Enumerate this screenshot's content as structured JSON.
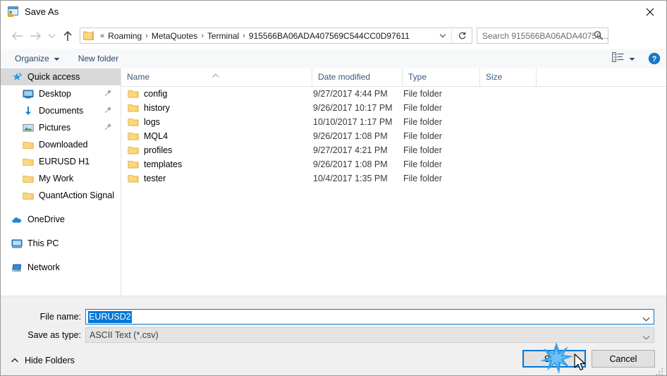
{
  "window": {
    "title": "Save As",
    "title_icon": "save-as-icon",
    "close_icon": "close-icon"
  },
  "nav": {
    "back_icon": "arrow-left-icon",
    "forward_icon": "arrow-right-icon",
    "recent_icon": "chevron-down-icon",
    "up_icon": "arrow-up-icon",
    "breadcrumb_icon": "folder-icon",
    "breadcrumb_overflow": "«",
    "crumbs": [
      "Roaming",
      "MetaQuotes",
      "Terminal",
      "915566BA06ADA407569C544CC0D97611"
    ],
    "separator": "›",
    "dropdown_icon": "chevron-down-icon",
    "refresh_icon": "refresh-icon"
  },
  "search": {
    "placeholder": "Search 915566BA06ADA40756...",
    "icon": "search-icon"
  },
  "toolbar": {
    "organize_label": "Organize",
    "organize_caret_icon": "caret-down-icon",
    "new_folder_label": "New folder",
    "view_icon": "list-view-icon",
    "view_caret_icon": "caret-down-icon",
    "help_icon": "help-icon"
  },
  "sidebar": {
    "items": [
      {
        "label": "Quick access",
        "icon": "star-pin-icon",
        "level": 0,
        "selected": true,
        "pinned": false
      },
      {
        "label": "Desktop",
        "icon": "desktop-icon",
        "level": 1,
        "selected": false,
        "pinned": true
      },
      {
        "label": "Documents",
        "icon": "documents-icon",
        "level": 1,
        "selected": false,
        "pinned": true
      },
      {
        "label": "Pictures",
        "icon": "pictures-icon",
        "level": 1,
        "selected": false,
        "pinned": true
      },
      {
        "label": "Downloaded",
        "icon": "folder-icon",
        "level": 1,
        "selected": false,
        "pinned": false
      },
      {
        "label": "EURUSD H1",
        "icon": "folder-icon",
        "level": 1,
        "selected": false,
        "pinned": false
      },
      {
        "label": "My Work",
        "icon": "folder-icon",
        "level": 1,
        "selected": false,
        "pinned": false
      },
      {
        "label": "QuantAction Signal",
        "icon": "folder-icon",
        "level": 1,
        "selected": false,
        "pinned": false
      },
      {
        "label": "OneDrive",
        "icon": "onedrive-icon",
        "level": 0,
        "selected": false,
        "pinned": false,
        "gap_before": true
      },
      {
        "label": "This PC",
        "icon": "this-pc-icon",
        "level": 0,
        "selected": false,
        "pinned": false,
        "gap_before": true
      },
      {
        "label": "Network",
        "icon": "network-icon",
        "level": 0,
        "selected": false,
        "pinned": false,
        "gap_before": true
      }
    ]
  },
  "filelist": {
    "columns": [
      "Name",
      "Date modified",
      "Type",
      "Size"
    ],
    "sort_indicator_icon": "sort-ascending-icon",
    "rows": [
      {
        "name": "config",
        "date": "9/27/2017 4:44 PM",
        "type": "File folder",
        "size": ""
      },
      {
        "name": "history",
        "date": "9/26/2017 10:17 PM",
        "type": "File folder",
        "size": ""
      },
      {
        "name": "logs",
        "date": "10/10/2017 1:17 PM",
        "type": "File folder",
        "size": ""
      },
      {
        "name": "MQL4",
        "date": "9/26/2017 1:08 PM",
        "type": "File folder",
        "size": ""
      },
      {
        "name": "profiles",
        "date": "9/27/2017 4:21 PM",
        "type": "File folder",
        "size": ""
      },
      {
        "name": "templates",
        "date": "9/26/2017 1:08 PM",
        "type": "File folder",
        "size": ""
      },
      {
        "name": "tester",
        "date": "10/4/2017 1:35 PM",
        "type": "File folder",
        "size": ""
      }
    ]
  },
  "form": {
    "filename_label": "File name:",
    "filename_value": "EURUSD2",
    "filetype_label": "Save as type:",
    "filetype_value": "ASCII Text (*.csv)",
    "dropdown_icon": "chevron-down-icon"
  },
  "footer": {
    "hide_folders_label": "Hide Folders",
    "hide_folders_icon": "chevron-up-icon",
    "save_label": "Save",
    "cancel_label": "Cancel",
    "cursor_icon": "mouse-pointer-icon",
    "click_effect_icon": "click-burst-icon",
    "resize_grip_icon": "resize-grip-icon"
  },
  "colors": {
    "accent": "#0078d7",
    "selection": "#d9d9d9",
    "folder": "#f8d070",
    "panel": "#f0f0f0"
  }
}
